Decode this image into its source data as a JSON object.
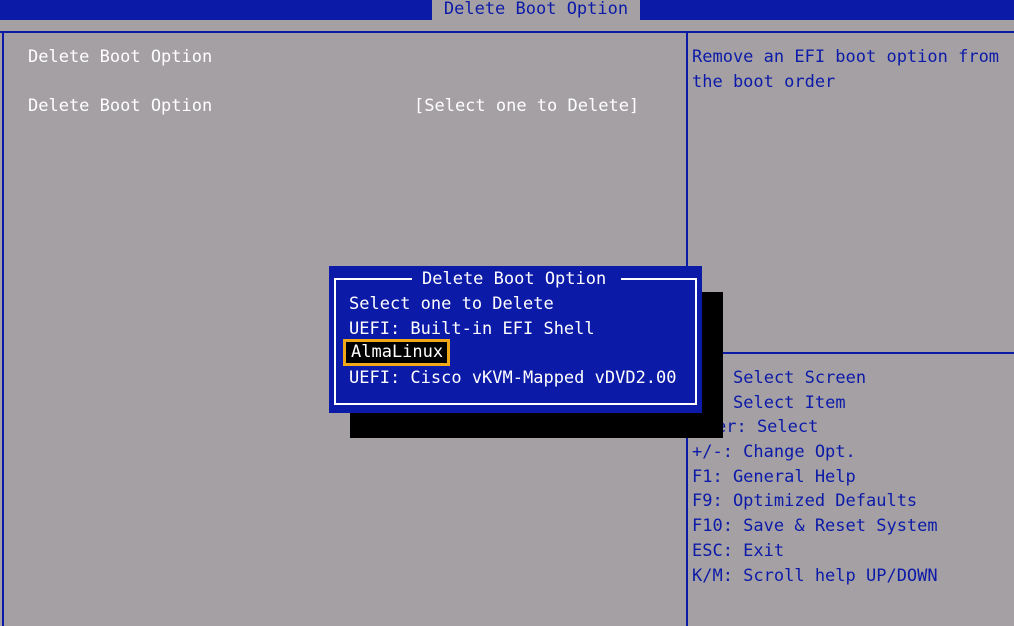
{
  "header": {
    "title": "Delete Boot Option"
  },
  "main": {
    "section_title": "Delete Boot Option",
    "option_label": "Delete Boot Option",
    "option_value": "[Select one to Delete]"
  },
  "help": {
    "description_line1": "Remove an EFI boot option from",
    "description_line2": "the boot order"
  },
  "keys": [
    "Select Screen",
    "Select Item",
    "er: Select",
    "+/-: Change Opt.",
    "F1: General Help",
    "F9: Optimized Defaults",
    "F10: Save & Reset System",
    "ESC: Exit",
    "K/M: Scroll help UP/DOWN"
  ],
  "popup": {
    "title": "Delete Boot Option",
    "items": [
      "Select one to Delete",
      "UEFI: Built-in EFI Shell",
      "AlmaLinux",
      "UEFI: Cisco vKVM-Mapped vDVD2.00"
    ],
    "selected_index": 2
  },
  "colors": {
    "background": "#a4a0a4",
    "accent_blue": "#0c1aa8",
    "selection_border": "#f0a818",
    "text": "#ffffff"
  }
}
